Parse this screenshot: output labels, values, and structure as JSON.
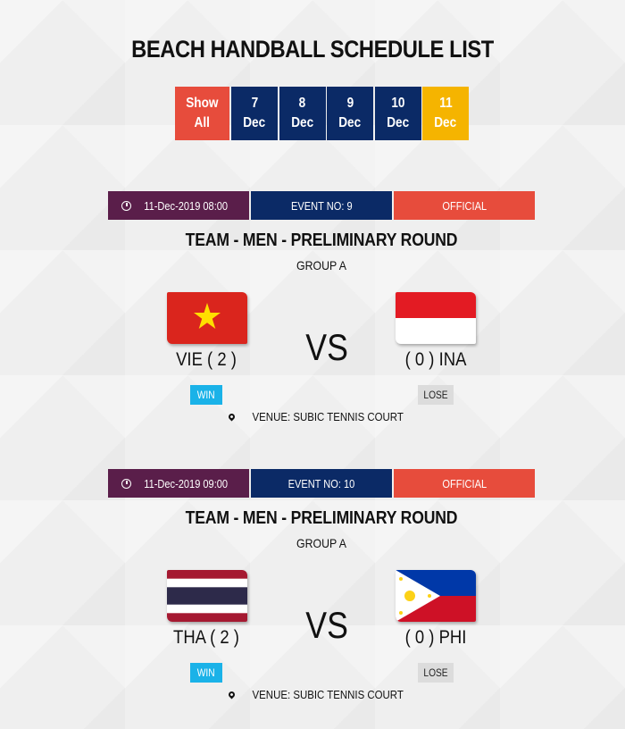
{
  "page": {
    "title": "BEACH HANDBALL SCHEDULE LIST"
  },
  "date_tabs": [
    {
      "line1": "Show",
      "line2": "All",
      "color": "#e74c3c",
      "selected": false
    },
    {
      "line1": "7",
      "line2": "Dec",
      "color": "#0b2a66",
      "selected": false
    },
    {
      "line1": "8",
      "line2": "Dec",
      "color": "#0b2a66",
      "selected": false
    },
    {
      "line1": "9",
      "line2": "Dec",
      "color": "#0b2a66",
      "selected": false
    },
    {
      "line1": "10",
      "line2": "Dec",
      "color": "#0b2a66",
      "selected": false
    },
    {
      "line1": "11",
      "line2": "Dec",
      "color": "#f5b400",
      "selected": true
    }
  ],
  "colors": {
    "datetime_bg": "#5a1e4a",
    "event_bg": "#0b2a66",
    "official_bg": "#e74c3c",
    "win_bg": "#1ab2e8",
    "lose_bg": "#dcdcdc"
  },
  "matches": [
    {
      "datetime": "11-Dec-2019 08:00",
      "event_no": "EVENT NO: 9",
      "status": "OFFICIAL",
      "title": "TEAM - MEN - PRELIMINARY ROUND",
      "group": "GROUP A",
      "home": {
        "name": "VIE ( 2 )",
        "flag": "vietnam-flag",
        "result": "WIN"
      },
      "away": {
        "name": "( 0 ) INA",
        "flag": "indonesia-flag",
        "result": "LOSE"
      },
      "vs": "VS",
      "venue": "VENUE: SUBIC TENNIS COURT"
    },
    {
      "datetime": "11-Dec-2019 09:00",
      "event_no": "EVENT NO: 10",
      "status": "OFFICIAL",
      "title": "TEAM - MEN - PRELIMINARY ROUND",
      "group": "GROUP A",
      "home": {
        "name": "THA ( 2 )",
        "flag": "thailand-flag",
        "result": "WIN"
      },
      "away": {
        "name": "( 0 ) PHI",
        "flag": "philippines-flag",
        "result": "LOSE"
      },
      "vs": "VS",
      "venue": "VENUE: SUBIC TENNIS COURT"
    }
  ]
}
